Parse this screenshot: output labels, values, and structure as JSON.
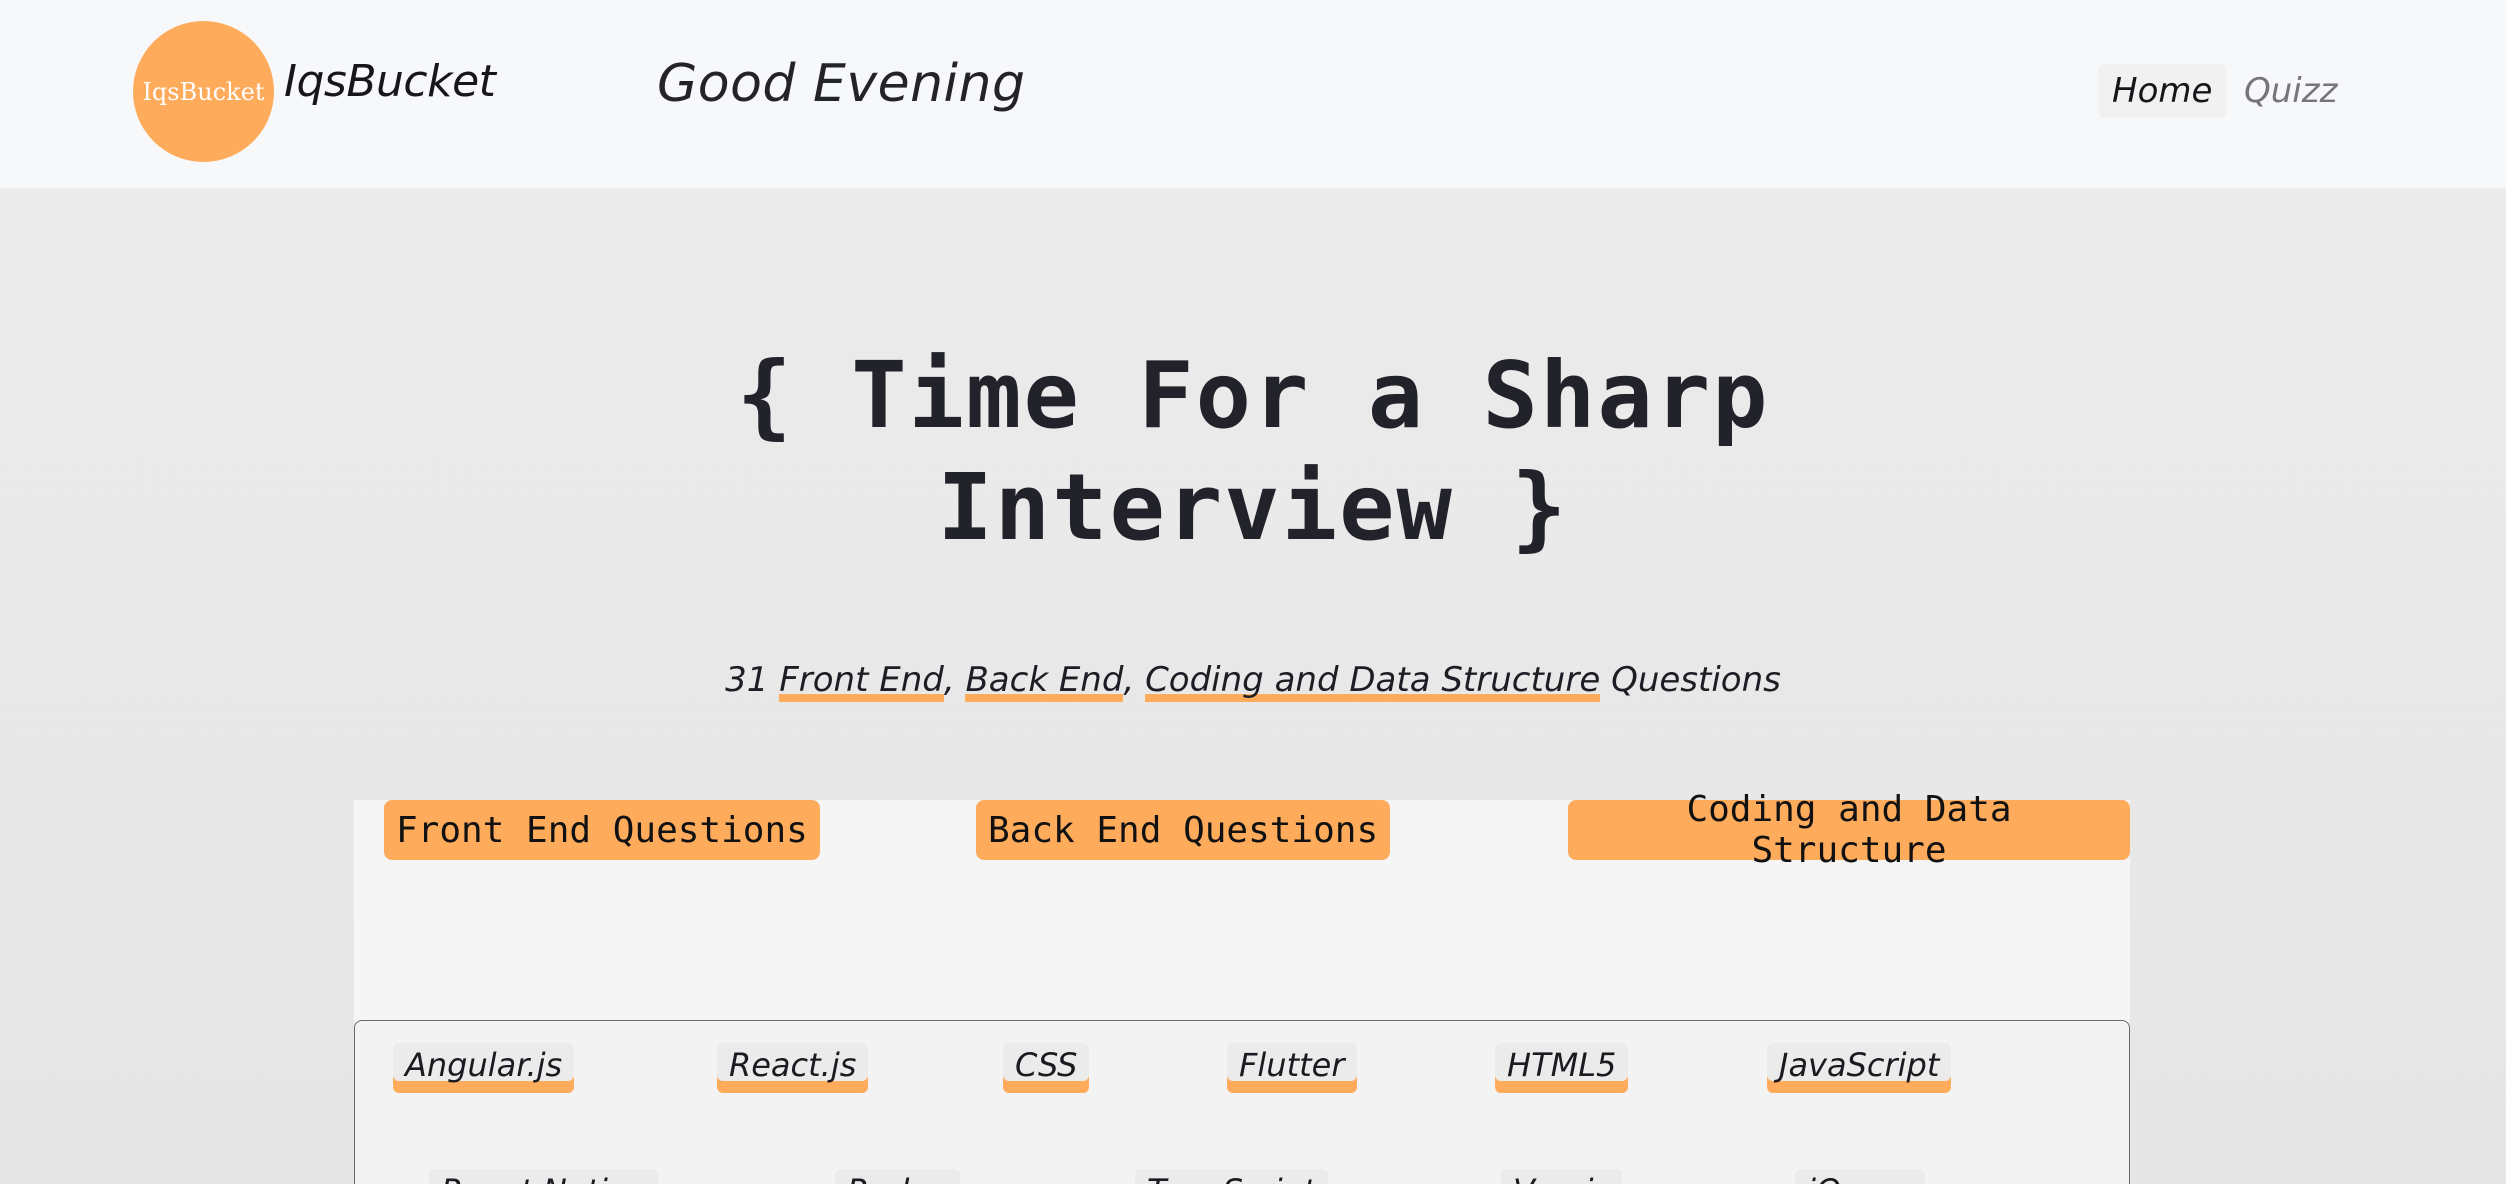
{
  "header": {
    "logo_text": "IqsBucket",
    "brand": "IqsBucket",
    "greeting": "Good Evening",
    "nav": [
      {
        "label": "Home"
      },
      {
        "label": "Quizz"
      }
    ]
  },
  "hero": {
    "title_line1": "{ Time For a Sharp",
    "title_line2": "Interview }",
    "subtitle": {
      "count": "31",
      "front_end": "Front End",
      "back_end": "Back End",
      "coding": "Coding and Data Structure",
      "suffix": "Questions"
    }
  },
  "categories": [
    {
      "label": "Front End Questions"
    },
    {
      "label": "Back End Questions"
    },
    {
      "label": "Coding and Data Structure"
    }
  ],
  "tags": [
    {
      "label": "Angular.js"
    },
    {
      "label": "React.js"
    },
    {
      "label": "CSS"
    },
    {
      "label": "Flutter"
    },
    {
      "label": "HTML5"
    },
    {
      "label": "JavaScript"
    },
    {
      "label": "React Native"
    },
    {
      "label": "Redux"
    },
    {
      "label": "TypeScript"
    },
    {
      "label": "Vue.js"
    },
    {
      "label": "jQuery"
    }
  ],
  "colors": {
    "accent": "#ffab5c",
    "header_bg": "#f7f8fa",
    "page_bg": "#ececec",
    "text": "#1c1c22",
    "nav_muted": "#75757a"
  }
}
